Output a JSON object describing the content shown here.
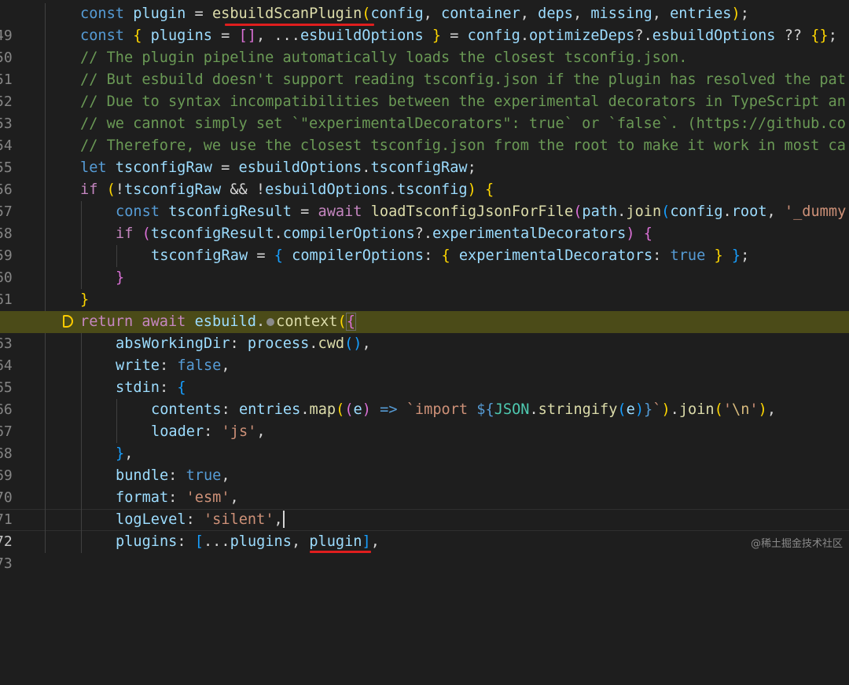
{
  "lines": [
    {
      "num": "49",
      "text": "const plugin = esbuildScanPlugin(config, container, deps, missing, entries);"
    },
    {
      "num": "50",
      "text": "const { plugins = [], ...esbuildOptions } = config.optimizeDeps?.esbuildOptions ?? {};"
    },
    {
      "num": "51",
      "text": "// The plugin pipeline automatically loads the closest tsconfig.json."
    },
    {
      "num": "52",
      "text": "// But esbuild doesn't support reading tsconfig.json if the plugin has resolved the pat"
    },
    {
      "num": "53",
      "text": "// Due to syntax incompatibilities between the experimental decorators in TypeScript an"
    },
    {
      "num": "54",
      "text": "// we cannot simply set `\"experimentalDecorators\": true` or `false`. (https://github.co"
    },
    {
      "num": "55",
      "text": "// Therefore, we use the closest tsconfig.json from the root to make it work in most ca"
    },
    {
      "num": "56",
      "text": "let tsconfigRaw = esbuildOptions.tsconfigRaw;"
    },
    {
      "num": "57",
      "text": "if (!tsconfigRaw && !esbuildOptions.tsconfig) {"
    },
    {
      "num": "58",
      "text": "const tsconfigResult = await loadTsconfigJsonForFile(path.join(config.root, '_dummy"
    },
    {
      "num": "59",
      "text": "if (tsconfigResult.compilerOptions?.experimentalDecorators) {"
    },
    {
      "num": "60",
      "text": "tsconfigRaw = { compilerOptions: { experimentalDecorators: true } };"
    },
    {
      "num": "61",
      "text": "}"
    },
    {
      "num": "62",
      "text": "}"
    },
    {
      "num": "63",
      "text": "return await esbuild.context({"
    },
    {
      "num": "64",
      "text": "absWorkingDir: process.cwd(),"
    },
    {
      "num": "65",
      "text": "write: false,"
    },
    {
      "num": "66",
      "text": "stdin: {"
    },
    {
      "num": "67",
      "text": "contents: entries.map((e) => `import ${JSON.stringify(e)}`).join('\\n'),"
    },
    {
      "num": "68",
      "text": "loader: 'js',"
    },
    {
      "num": "69",
      "text": "},"
    },
    {
      "num": "70",
      "text": "bundle: true,"
    },
    {
      "num": "71",
      "text": "format: 'esm',"
    },
    {
      "num": "72",
      "text": "logLevel: 'silent',"
    },
    {
      "num": "73",
      "text": "plugins: [...plugins, plugin],"
    }
  ],
  "watermark": "@稀土掘金技术社区",
  "colors": {
    "background": "#1e1e1e",
    "keyword": "#569cd6",
    "control": "#c586c0",
    "variable": "#9cdcfe",
    "function": "#dcdcaa",
    "comment": "#6a9955",
    "string": "#ce9178",
    "execution_highlight": "#4b4b18",
    "breakpoint": "#ffcc00",
    "annotation_underline": "#e01e1e"
  },
  "icons": [
    "debug-current-line-arrow-icon",
    "inline-breakpoint-dot-icon"
  ]
}
